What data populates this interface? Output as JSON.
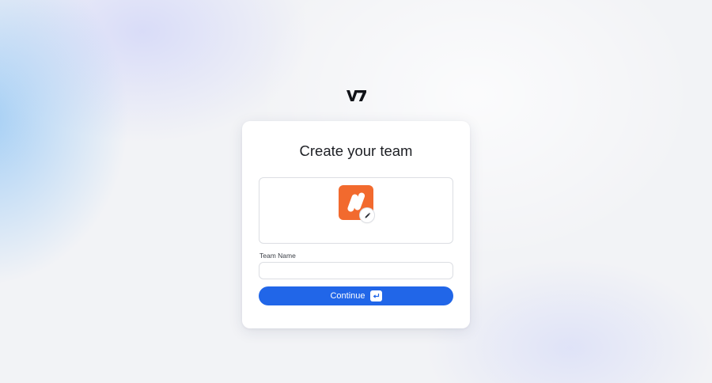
{
  "brand": {
    "logo_text": "V7"
  },
  "dialog": {
    "title": "Create your team",
    "avatar": {
      "color": "#f26a2e",
      "edit_icon": "pencil-icon"
    },
    "team_name": {
      "label": "Team Name",
      "value": "",
      "placeholder": ""
    },
    "continue_button": {
      "label": "Continue",
      "shortcut_icon": "enter-key-icon"
    }
  },
  "colors": {
    "accent": "#2166e8",
    "avatar_bg": "#f26a2e"
  }
}
